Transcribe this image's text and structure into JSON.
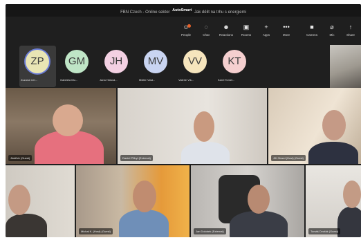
{
  "window": {
    "title_left": "FBN Czech - Online sektor",
    "brand": "AutoSmart",
    "title_right": "Jak dělit na trhu s energiemi"
  },
  "toolbar": {
    "items": [
      {
        "label": "People",
        "icon": "people-icon",
        "glyph": "☺"
      },
      {
        "label": "Chat",
        "icon": "chat-icon",
        "glyph": "◌"
      },
      {
        "label": "Reactions",
        "icon": "reactions-icon",
        "glyph": "☻"
      },
      {
        "label": "Rooms",
        "icon": "rooms-icon",
        "glyph": "▣"
      },
      {
        "label": "Apps",
        "icon": "apps-icon",
        "glyph": "+"
      },
      {
        "label": "More",
        "icon": "more-icon",
        "glyph": "•••"
      },
      {
        "label": "Camera",
        "icon": "camera-icon",
        "glyph": "■"
      },
      {
        "label": "Mic",
        "icon": "mic-icon",
        "glyph": "⌀"
      },
      {
        "label": "Share",
        "icon": "share-icon",
        "glyph": "↑"
      }
    ]
  },
  "participants_strip": [
    {
      "initials": "ZP",
      "name": "Zuzana Cer...",
      "color": "#e9e5b4"
    },
    {
      "initials": "GM",
      "name": "Gabriela Mu...",
      "color": "#bfe5c6"
    },
    {
      "initials": "JH",
      "name": "Jana Hülová...",
      "color": "#f3d0e2"
    },
    {
      "initials": "MV",
      "name": "Müller Vlad...",
      "color": "#c9d4f1"
    },
    {
      "initials": "VV",
      "name": "Valerie Vlk...",
      "color": "#f6e5bd"
    },
    {
      "initials": "KT",
      "name": "Karel Tomel...",
      "color": "#f5cfcf"
    }
  ],
  "video_tiles": [
    {
      "name": "Jindřich (Guest)"
    },
    {
      "name": "Daniel Přibyl (External)"
    },
    {
      "name": "Jiří Girard (Host) (Guest)"
    },
    {
      "name": ""
    },
    {
      "name": "Michal K. (Host) (Guest)"
    },
    {
      "name": "Jan Dolobek (External)"
    },
    {
      "name": "Tomáš Dvořák (Guest)"
    }
  ]
}
